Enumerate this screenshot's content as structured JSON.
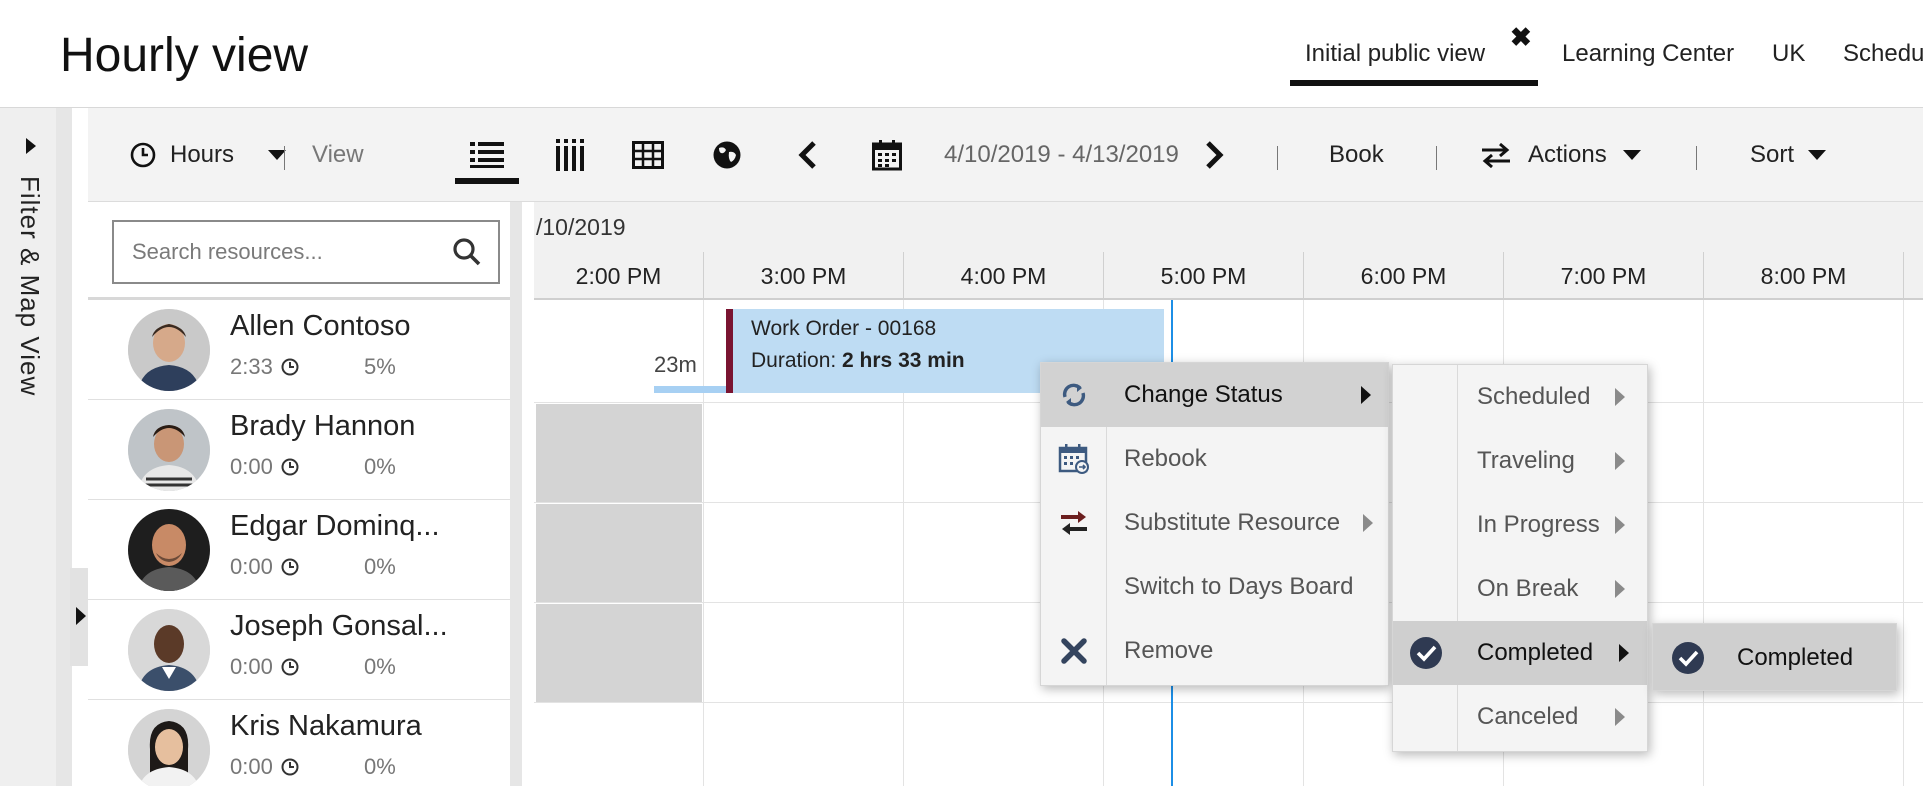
{
  "header": {
    "title": "Hourly view",
    "tabs": [
      {
        "label": "Initial public view",
        "active": true
      },
      {
        "label": "Learning Center"
      },
      {
        "label": "UK"
      },
      {
        "label": "Schedu"
      }
    ]
  },
  "filter_rail": {
    "label": "Filter & Map View"
  },
  "toolbar": {
    "hours_label": "Hours",
    "view_label": "View",
    "date_range": "4/10/2019 - 4/13/2019",
    "book_label": "Book",
    "actions_label": "Actions",
    "sort_label": "Sort"
  },
  "search": {
    "placeholder": "Search resources..."
  },
  "resources": [
    {
      "name": "Allen Contoso",
      "hours": "2:33",
      "utilization": "5%"
    },
    {
      "name": "Brady Hannon",
      "hours": "0:00",
      "utilization": "0%"
    },
    {
      "name": "Edgar Dominq...",
      "hours": "0:00",
      "utilization": "0%"
    },
    {
      "name": "Joseph Gonsal...",
      "hours": "0:00",
      "utilization": "0%"
    },
    {
      "name": "Kris Nakamura",
      "hours": "0:00",
      "utilization": "0%"
    }
  ],
  "schedule": {
    "date": "/10/2019",
    "times": [
      "2:00 PM",
      "3:00 PM",
      "4:00 PM",
      "5:00 PM",
      "6:00 PM",
      "7:00 PM",
      "8:00 PM"
    ],
    "travel_label": "23m",
    "booking": {
      "title": "Work Order - 00168",
      "duration_prefix": "Duration: ",
      "duration_value": "2 hrs 33 min"
    }
  },
  "context_menu": {
    "items": [
      {
        "label": "Change Status",
        "icon": "change-status-icon",
        "highlighted": true
      },
      {
        "label": "Rebook",
        "icon": "calendar-icon"
      },
      {
        "label": "Substitute Resource",
        "icon": "swap-icon"
      },
      {
        "label": "Switch to Days Board"
      },
      {
        "label": "Remove",
        "icon": "close-icon"
      }
    ]
  },
  "status_menu": {
    "items": [
      {
        "label": "Scheduled"
      },
      {
        "label": "Traveling"
      },
      {
        "label": "In Progress"
      },
      {
        "label": "On Break"
      },
      {
        "label": "Completed",
        "highlighted": true
      },
      {
        "label": "Canceled"
      }
    ]
  },
  "sub_menu": {
    "label": "Completed"
  },
  "colors": {
    "booking_fill": "#bedcf3",
    "booking_accent": "#7a1431",
    "now_line": "#1c8ee6",
    "menu_highlight": "#d2d2d2",
    "check_circle": "#2f3a52"
  }
}
